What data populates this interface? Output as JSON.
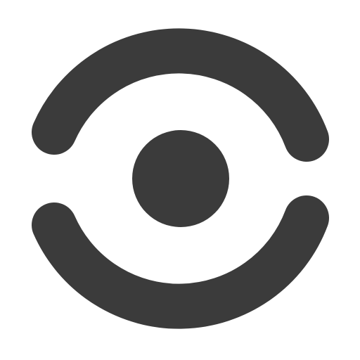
{
  "icon": {
    "name": "eye-focus-icon",
    "color": "#3b3b3b",
    "background": "#ffffff"
  }
}
